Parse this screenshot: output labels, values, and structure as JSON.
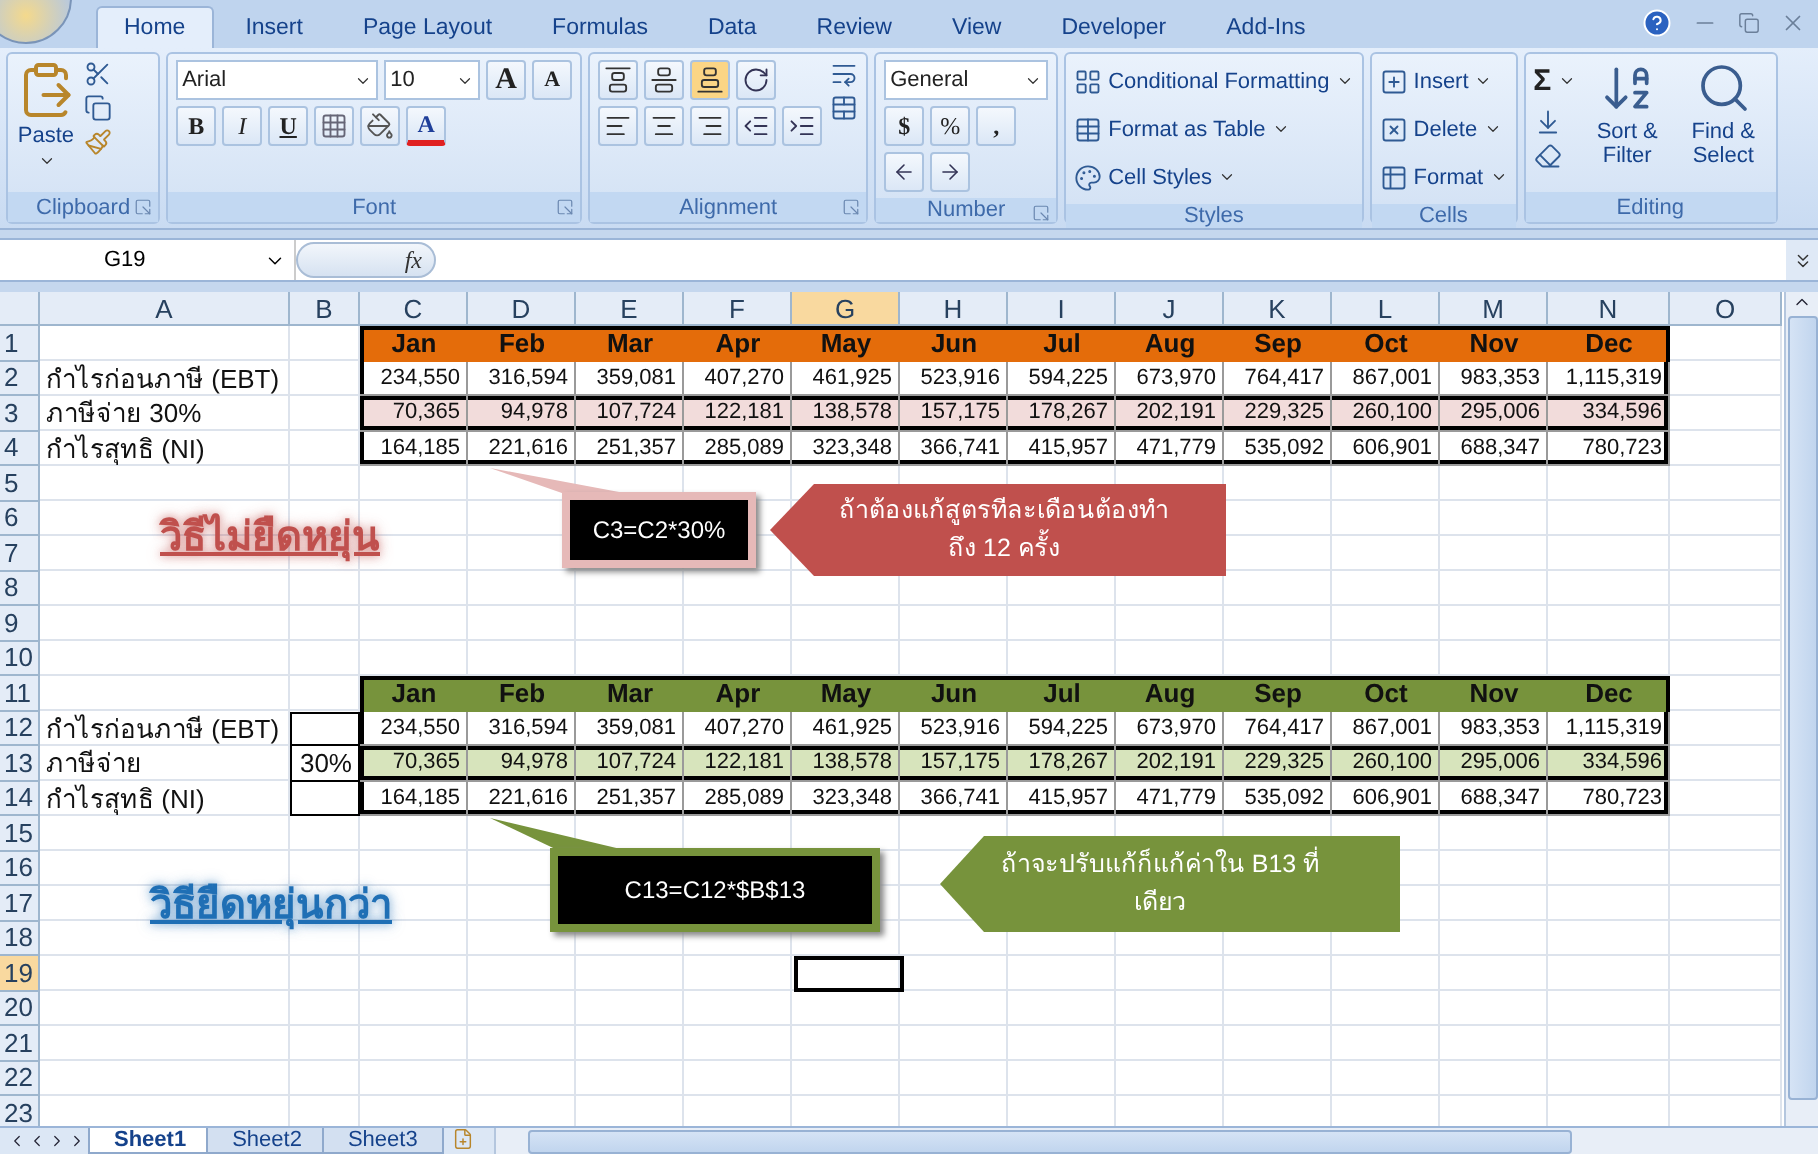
{
  "ribbon": {
    "tabs": [
      {
        "label": "Home",
        "selected": true
      },
      {
        "label": "Insert",
        "selected": false
      },
      {
        "label": "Page Layout",
        "selected": false
      },
      {
        "label": "Formulas",
        "selected": false
      },
      {
        "label": "Data",
        "selected": false
      },
      {
        "label": "Review",
        "selected": false
      },
      {
        "label": "View",
        "selected": false
      },
      {
        "label": "Developer",
        "selected": false
      },
      {
        "label": "Add-Ins",
        "selected": false
      }
    ],
    "groups": [
      {
        "kind": "clipboard",
        "label": "Clipboard",
        "paste": "Paste"
      },
      {
        "kind": "font",
        "label": "Font",
        "font_name": "Arial",
        "font_size": "10",
        "grow": "A",
        "shrink": "A",
        "bold": "B",
        "italic": "I",
        "underline": "U",
        "font_color": "A"
      },
      {
        "kind": "alignment",
        "label": "Alignment",
        "vertical_align": [
          {
            "selected": false
          },
          {
            "selected": false
          },
          {
            "selected": true
          }
        ]
      },
      {
        "kind": "number",
        "label": "Number",
        "format": "General",
        "currency": "$",
        "percent": "%",
        "comma": ","
      },
      {
        "kind": "styles",
        "label": "Styles",
        "commands": [
          "Conditional Formatting",
          "Format as Table",
          "Cell Styles"
        ]
      },
      {
        "kind": "cells",
        "label": "Cells",
        "commands": [
          "Insert",
          "Delete",
          "Format"
        ]
      },
      {
        "kind": "editing",
        "label": "Editing",
        "sum": "Σ",
        "commands": [
          "Sort & Filter",
          "Find & Select"
        ]
      }
    ]
  },
  "formula_bar": {
    "name_box": "G19",
    "function_label": "fx"
  },
  "columns": [
    {
      "label": "A",
      "selected": false
    },
    {
      "label": "B",
      "selected": false
    },
    {
      "label": "C",
      "selected": false
    },
    {
      "label": "D",
      "selected": false
    },
    {
      "label": "E",
      "selected": false
    },
    {
      "label": "F",
      "selected": false
    },
    {
      "label": "G",
      "selected": true
    },
    {
      "label": "H",
      "selected": false
    },
    {
      "label": "I",
      "selected": false
    },
    {
      "label": "J",
      "selected": false
    },
    {
      "label": "K",
      "selected": false
    },
    {
      "label": "L",
      "selected": false
    },
    {
      "label": "M",
      "selected": false
    },
    {
      "label": "N",
      "selected": false
    },
    {
      "label": "O",
      "selected": false
    }
  ],
  "rows": [
    {
      "label": "1",
      "selected": false
    },
    {
      "label": "2",
      "selected": false
    },
    {
      "label": "3",
      "selected": false
    },
    {
      "label": "4",
      "selected": false
    },
    {
      "label": "5",
      "selected": false
    },
    {
      "label": "6",
      "selected": false
    },
    {
      "label": "7",
      "selected": false
    },
    {
      "label": "8",
      "selected": false
    },
    {
      "label": "9",
      "selected": false
    },
    {
      "label": "10",
      "selected": false
    },
    {
      "label": "11",
      "selected": false
    },
    {
      "label": "12",
      "selected": false
    },
    {
      "label": "13",
      "selected": false
    },
    {
      "label": "14",
      "selected": false
    },
    {
      "label": "15",
      "selected": false
    },
    {
      "label": "16",
      "selected": false
    },
    {
      "label": "17",
      "selected": false
    },
    {
      "label": "18",
      "selected": false
    },
    {
      "label": "19",
      "selected": true
    },
    {
      "label": "20",
      "selected": false
    },
    {
      "label": "21",
      "selected": false
    },
    {
      "label": "22",
      "selected": false
    },
    {
      "label": "23",
      "selected": false
    }
  ],
  "tables": [
    {
      "color": "#e46c0a",
      "months": [
        "Jan",
        "Feb",
        "Mar",
        "Apr",
        "May",
        "Jun",
        "Jul",
        "Aug",
        "Sep",
        "Oct",
        "Nov",
        "Dec"
      ],
      "rows": [
        {
          "label": "กำไรก่อนภาษี (EBT)",
          "color": "#ffffff",
          "values": [
            "234,550",
            "316,594",
            "359,081",
            "407,270",
            "461,925",
            "523,916",
            "594,225",
            "673,970",
            "764,417",
            "867,001",
            "983,353",
            "1,115,319"
          ]
        },
        {
          "label": "ภาษีจ่าย 30%",
          "color": "#f2dcdb",
          "values": [
            "70,365",
            "94,978",
            "107,724",
            "122,181",
            "138,578",
            "157,175",
            "178,267",
            "202,191",
            "229,325",
            "260,100",
            "295,006",
            "334,596"
          ]
        },
        {
          "label": "กำไรสุทธิ (NI)",
          "color": "#ffffff",
          "values": [
            "164,185",
            "221,616",
            "251,357",
            "285,089",
            "323,348",
            "366,741",
            "415,957",
            "471,779",
            "535,092",
            "606,901",
            "688,347",
            "780,723"
          ]
        }
      ]
    },
    {
      "color": "#77933c",
      "input_column": true,
      "months": [
        "Jan",
        "Feb",
        "Mar",
        "Apr",
        "May",
        "Jun",
        "Jul",
        "Aug",
        "Sep",
        "Oct",
        "Nov",
        "Dec"
      ],
      "rows": [
        {
          "label": "กำไรก่อนภาษี (EBT)",
          "color": "#ffffff",
          "values": [
            "234,550",
            "316,594",
            "359,081",
            "407,270",
            "461,925",
            "523,916",
            "594,225",
            "673,970",
            "764,417",
            "867,001",
            "983,353",
            "1,115,319"
          ]
        },
        {
          "label": "ภาษีจ่าย",
          "rate": "30%",
          "color": "#d7e4bc",
          "values": [
            "70,365",
            "94,978",
            "107,724",
            "122,181",
            "138,578",
            "157,175",
            "178,267",
            "202,191",
            "229,325",
            "260,100",
            "295,006",
            "334,596"
          ]
        },
        {
          "label": "กำไรสุทธิ (NI)",
          "color": "#ffffff",
          "values": [
            "164,185",
            "221,616",
            "251,357",
            "285,089",
            "323,348",
            "366,741",
            "415,957",
            "471,779",
            "535,092",
            "606,901",
            "688,347",
            "780,723"
          ]
        }
      ]
    }
  ],
  "headings": [
    {
      "text": "วิธีไม่ยืดหยุ่น",
      "color": "#c0504d"
    },
    {
      "text": "วิธียืดหยุ่นกว่า",
      "color": "#1f6fb5"
    }
  ],
  "callouts": [
    {
      "kind": "formula",
      "text": "C3=C2*30%",
      "color": "#e6b9b8"
    },
    {
      "kind": "note",
      "text": "ถ้าต้องแก้สูตรทีละเดือนต้องทำ ถึง 12 ครั้ง",
      "color": "#c0504d"
    },
    {
      "kind": "formula",
      "text": "C13=C12*$B$13",
      "color": "#77933c"
    },
    {
      "kind": "note",
      "text": "ถ้าจะปรับแก้ก็แก้ค่าใน B13 ที่เดียว",
      "color": "#77933c"
    }
  ],
  "sheet_tabs": [
    {
      "label": "Sheet1",
      "selected": true
    },
    {
      "label": "Sheet2",
      "selected": false
    },
    {
      "label": "Sheet3",
      "selected": false
    }
  ]
}
